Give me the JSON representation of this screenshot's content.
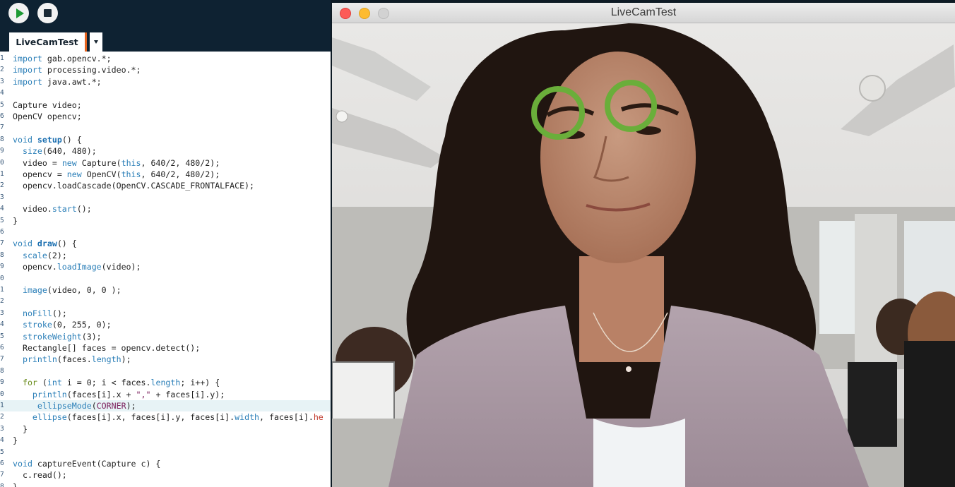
{
  "ide": {
    "toolbar": {
      "run_label": "Run",
      "stop_label": "Stop"
    },
    "tab_name": "LiveCamTest",
    "lines": [
      {
        "n": "1",
        "html": "<span class='kw'>import</span> gab.opencv.*;"
      },
      {
        "n": "2",
        "html": "<span class='kw'>import</span> processing.video.*;"
      },
      {
        "n": "3",
        "html": "<span class='kw'>import</span> java.awt.*;"
      },
      {
        "n": "4",
        "html": ""
      },
      {
        "n": "5",
        "html": "Capture video;"
      },
      {
        "n": "6",
        "html": "OpenCV opencv;"
      },
      {
        "n": "7",
        "html": ""
      },
      {
        "n": "8",
        "html": "<span class='kw'>void</span> <span class='fn'>setup</span>() {"
      },
      {
        "n": "9",
        "html": "  <span class='call'>size</span>(640, 480);"
      },
      {
        "n": "0",
        "html": "  video = <span class='kw'>new</span> Capture(<span class='kw'>this</span>, 640/2, 480/2);"
      },
      {
        "n": "1",
        "html": "  opencv = <span class='kw'>new</span> OpenCV(<span class='kw'>this</span>, 640/2, 480/2);"
      },
      {
        "n": "2",
        "html": "  opencv.loadCascade(OpenCV.CASCADE_FRONTALFACE);"
      },
      {
        "n": "3",
        "html": ""
      },
      {
        "n": "4",
        "html": "  video.<span class='call'>start</span>();"
      },
      {
        "n": "5",
        "html": "}"
      },
      {
        "n": "6",
        "html": ""
      },
      {
        "n": "7",
        "html": "<span class='kw'>void</span> <span class='fn'>draw</span>() {"
      },
      {
        "n": "8",
        "html": "  <span class='call'>scale</span>(2);"
      },
      {
        "n": "9",
        "html": "  opencv.<span class='call'>loadImage</span>(video);"
      },
      {
        "n": "0",
        "html": ""
      },
      {
        "n": "1",
        "html": "  <span class='call'>image</span>(video, 0, 0 );"
      },
      {
        "n": "2",
        "html": ""
      },
      {
        "n": "3",
        "html": "  <span class='call'>noFill</span>();"
      },
      {
        "n": "4",
        "html": "  <span class='call'>stroke</span>(0, 255, 0);"
      },
      {
        "n": "5",
        "html": "  <span class='call'>strokeWeight</span>(3);"
      },
      {
        "n": "6",
        "html": "  Rectangle[] faces = opencv.detect();"
      },
      {
        "n": "7",
        "html": "  <span class='call'>println</span>(faces.<span class='call'>length</span>);"
      },
      {
        "n": "8",
        "html": ""
      },
      {
        "n": "9",
        "html": "  <span class='flow'>for</span> (<span class='kw'>int</span> i = 0; i &lt; faces.<span class='call'>length</span>; i++) {"
      },
      {
        "n": "0",
        "html": "    <span class='call'>println</span>(faces[i].x + <span class='str'>\",\"</span> + faces[i].y);"
      },
      {
        "n": "1",
        "html": "     <span class='call'>ellipseMode</span>(<span class='const'>CORNER</span>);",
        "current": true
      },
      {
        "n": "2",
        "html": "    <span class='call'>ellipse</span>(faces[i].x, faces[i].y, faces[i].<span class='call'>width</span>, faces[i].<span class='clip'>he</span>"
      },
      {
        "n": "3",
        "html": "  }"
      },
      {
        "n": "4",
        "html": "}"
      },
      {
        "n": "5",
        "html": ""
      },
      {
        "n": "6",
        "html": "<span class='kw'>void</span> captureEvent(Capture c) {"
      },
      {
        "n": "7",
        "html": "  c.read();"
      },
      {
        "n": "8",
        "html": "}"
      }
    ]
  },
  "window": {
    "title": "LiveCamTest"
  },
  "colors": {
    "ide_dark": "#0e2232",
    "detection_stroke": "#6aae3a",
    "run_green": "#1e9a34"
  }
}
